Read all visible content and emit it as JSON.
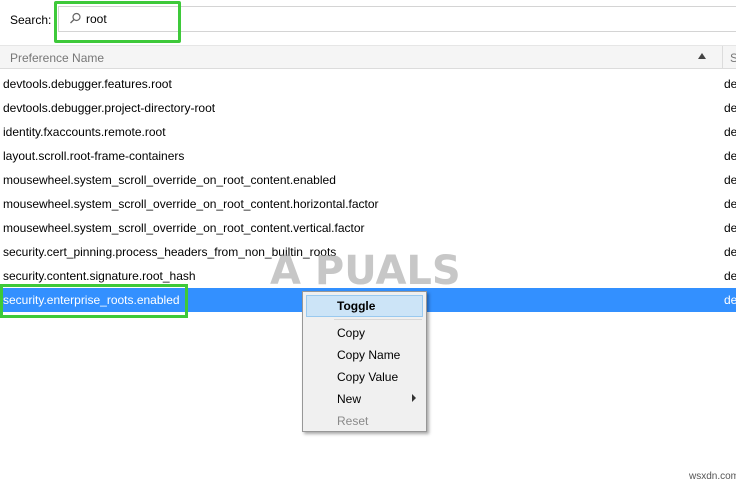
{
  "search": {
    "label": "Search:",
    "value": "root",
    "icon": "search-icon"
  },
  "table": {
    "column_name": "Preference Name",
    "column_status_fragment": "S",
    "rows": [
      {
        "name": "devtools.debugger.features.root",
        "status": "de"
      },
      {
        "name": "devtools.debugger.project-directory-root",
        "status": "de"
      },
      {
        "name": "identity.fxaccounts.remote.root",
        "status": "de"
      },
      {
        "name": "layout.scroll.root-frame-containers",
        "status": "de"
      },
      {
        "name": "mousewheel.system_scroll_override_on_root_content.enabled",
        "status": "de"
      },
      {
        "name": "mousewheel.system_scroll_override_on_root_content.horizontal.factor",
        "status": "de"
      },
      {
        "name": "mousewheel.system_scroll_override_on_root_content.vertical.factor",
        "status": "de"
      },
      {
        "name": "security.cert_pinning.process_headers_from_non_builtin_roots",
        "status": "de"
      },
      {
        "name": "security.content.signature.root_hash",
        "status": "de"
      },
      {
        "name": "security.enterprise_roots.enabled",
        "status": "de"
      }
    ],
    "selected_index": 9
  },
  "context_menu": {
    "items": [
      {
        "label": "Toggle"
      },
      {
        "label": "Copy"
      },
      {
        "label": "Copy Name"
      },
      {
        "label": "Copy Value"
      },
      {
        "label": "New"
      },
      {
        "label": "Reset"
      }
    ]
  },
  "watermark": {
    "text": "A PUALS"
  },
  "site": {
    "text": "wsxdn.com"
  },
  "colors": {
    "selection": "#3390ff",
    "highlight_box": "#3ec93a",
    "menu_hover": "#cce4f7"
  }
}
